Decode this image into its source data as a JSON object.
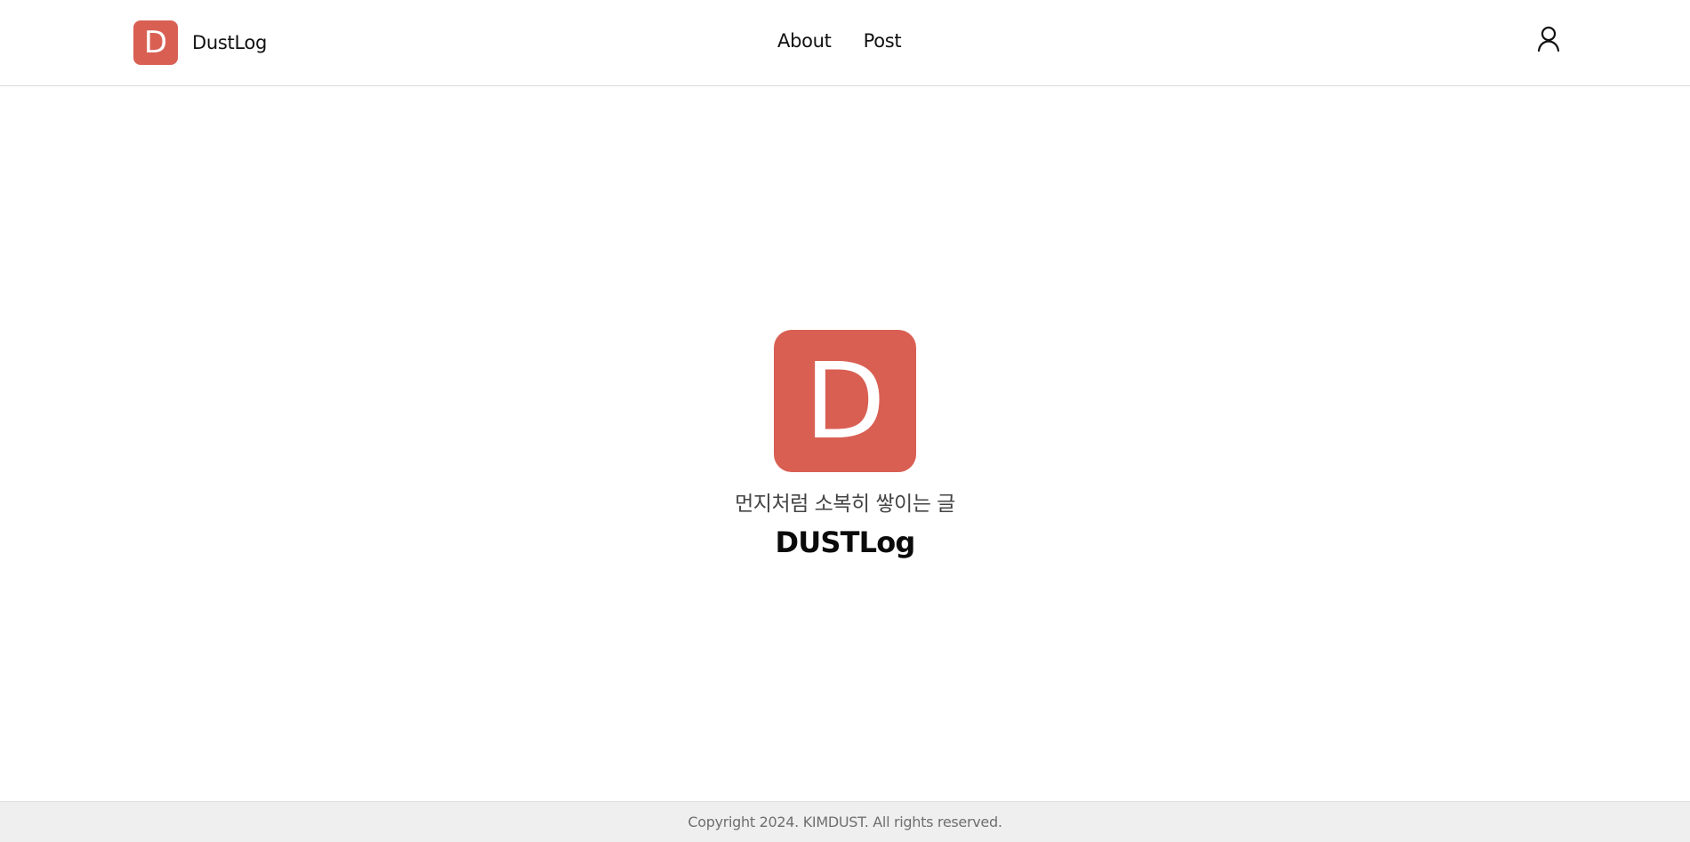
{
  "header": {
    "brand": {
      "logo_letter": "D",
      "name": "DustLog",
      "logo_color": "#d95f53"
    },
    "nav": [
      {
        "label": "About"
      },
      {
        "label": "Post"
      }
    ],
    "user_icon": "user-icon"
  },
  "hero": {
    "logo_letter": "D",
    "logo_color": "#d95f53",
    "tagline": "먼지처럼 소복히 쌓이는 글",
    "title": "DUSTLog"
  },
  "footer": {
    "copyright": "Copyright 2024. KIMDUST. All rights reserved."
  }
}
